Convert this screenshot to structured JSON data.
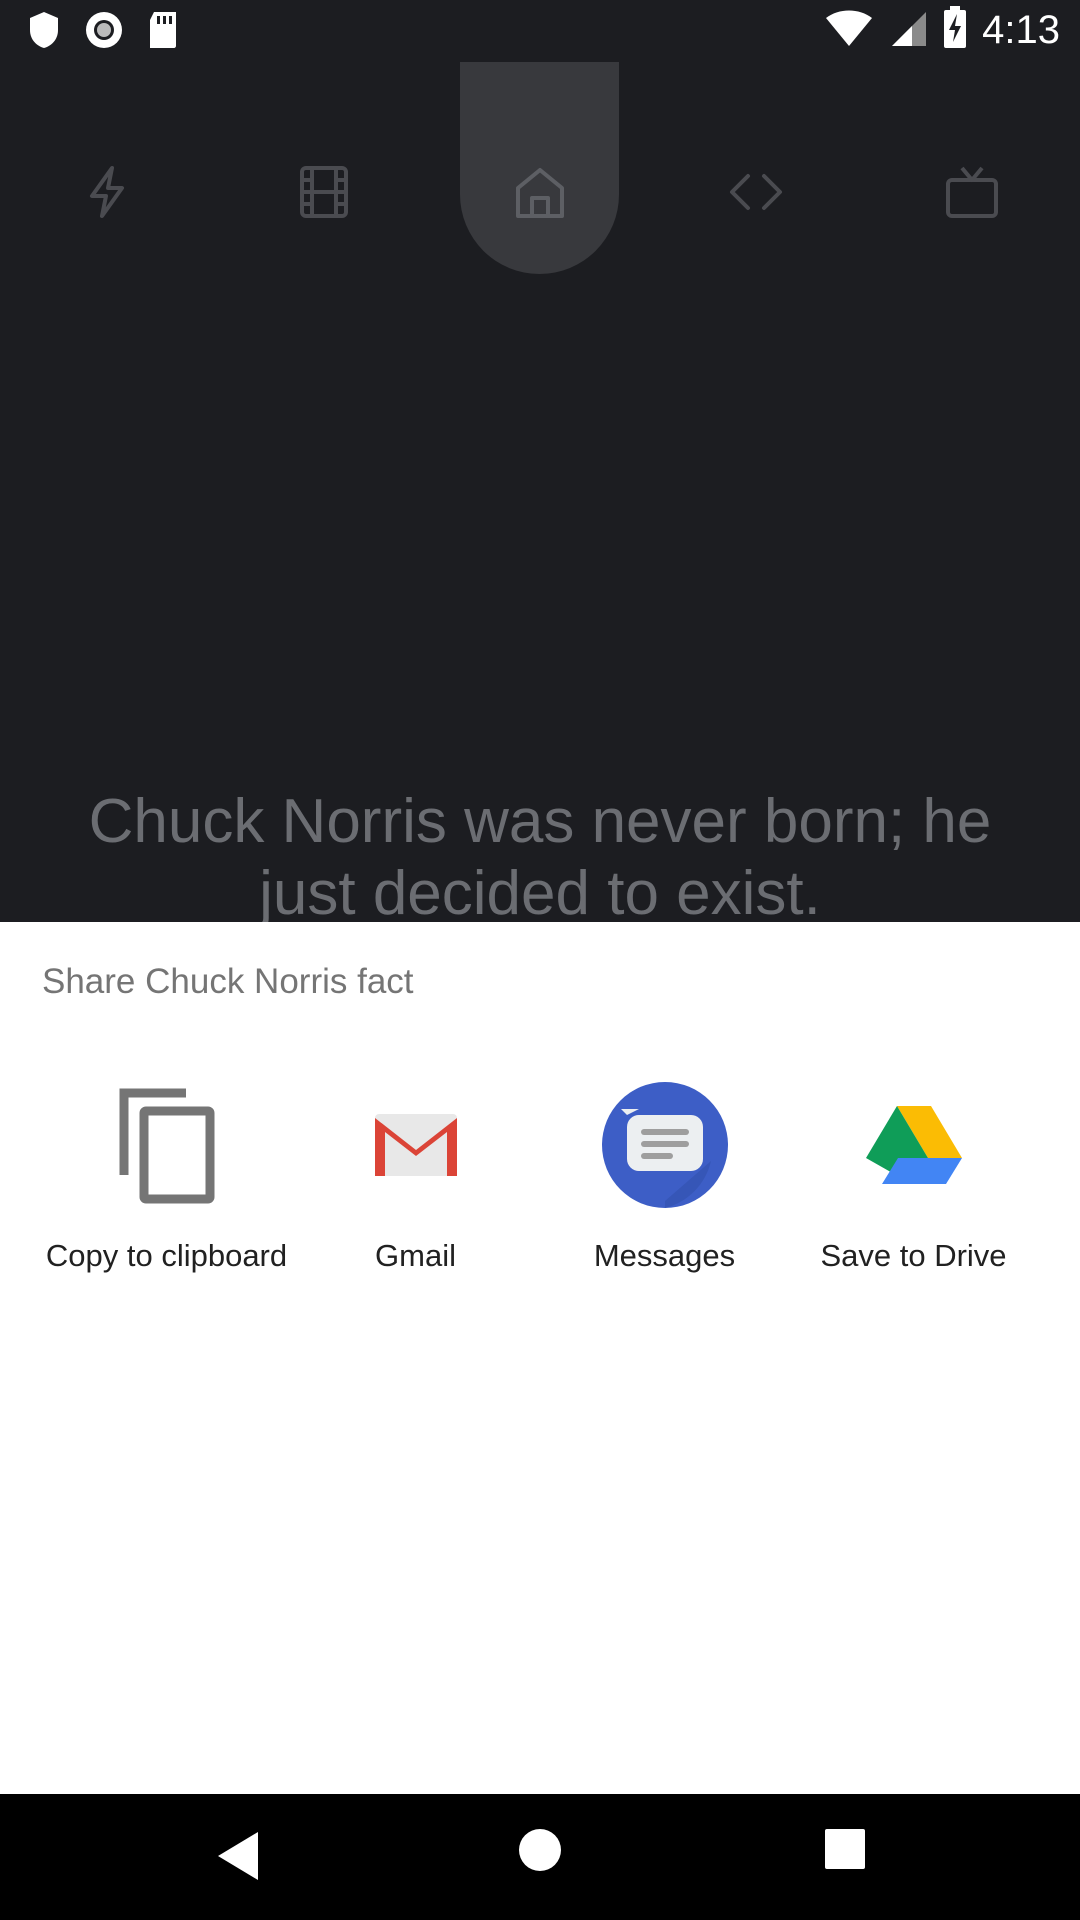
{
  "status_bar": {
    "time": "4:13",
    "left_icons": [
      "shield-icon",
      "record-icon",
      "sd-card-icon"
    ],
    "right_icons": [
      "wifi-icon",
      "cell-signal-icon",
      "battery-charging-icon"
    ]
  },
  "top_nav": {
    "items": [
      "flash-icon",
      "film-icon",
      "home-icon",
      "code-icon",
      "tv-icon"
    ],
    "selected": "home-icon"
  },
  "fact": {
    "text": "Chuck Norris was never born; he just decided to exist."
  },
  "share_sheet": {
    "title": "Share Chuck Norris fact",
    "targets": [
      {
        "label": "Copy to clipboard",
        "icon": "copy-icon"
      },
      {
        "label": "Gmail",
        "icon": "gmail-icon"
      },
      {
        "label": "Messages",
        "icon": "messages-icon"
      },
      {
        "label": "Save to Drive",
        "icon": "drive-icon"
      }
    ]
  },
  "nav_bar": {
    "buttons": [
      "back-icon",
      "home-circle-icon",
      "recents-icon"
    ]
  },
  "colors": {
    "app_background": "#1c1d21",
    "sheet_background": "#ffffff",
    "messages_blue": "#3d5ec6",
    "gmail_red": "#db4437"
  }
}
